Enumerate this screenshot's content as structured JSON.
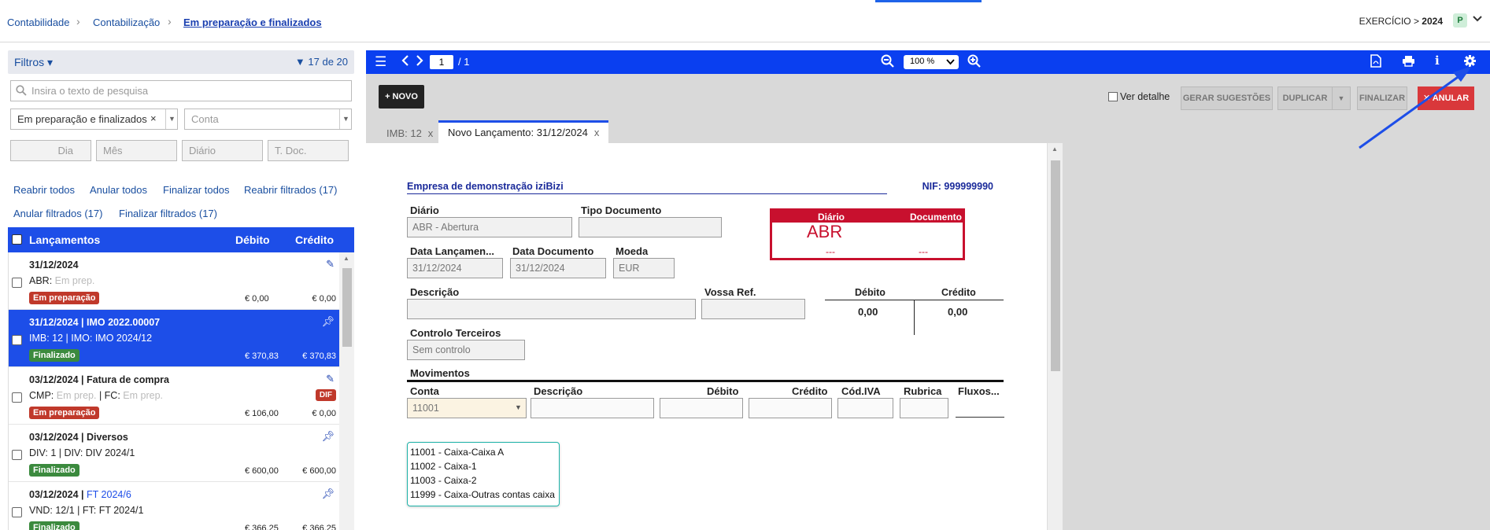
{
  "breadcrumb": [
    "Contabilidade",
    "Contabilização",
    "Em preparação e finalizados"
  ],
  "exercicio": {
    "label": "EXERCÍCIO >",
    "year": "2024",
    "badge": "P"
  },
  "filters": {
    "label": "Filtros",
    "count": "17 de 20",
    "search_placeholder": "Insira o texto de pesquisa",
    "status_value": "Em preparação e finalizados",
    "conta_placeholder": "Conta",
    "dia_placeholder": "Dia",
    "mes_placeholder": "Mês",
    "diario_placeholder": "Diário",
    "tdoc_placeholder": "T. Doc."
  },
  "actions": [
    "Reabrir todos",
    "Anular todos",
    "Finalizar todos",
    "Reabrir filtrados (17)",
    "Anular filtrados (17)",
    "Finalizar filtrados (17)"
  ],
  "list": {
    "headers": {
      "lancamentos": "Lançamentos",
      "debito": "Débito",
      "credito": "Crédito"
    },
    "rows": [
      {
        "date": "31/12/2024",
        "num": "",
        "line1a": "ABR:",
        "line1b": "Em prep.",
        "line1c": "",
        "line1d": "",
        "status": "Em preparação",
        "debit": "€ 0,00",
        "credit": "€ 0,00"
      },
      {
        "date": "31/12/2024 | IMO 2022.00007",
        "num": "",
        "line1a": "IMB: 12 | IMO: IMO 2024/12",
        "line1b": "",
        "line1c": "",
        "line1d": "",
        "status": "Finalizado",
        "debit": "€ 370,83",
        "credit": "€ 370,83"
      },
      {
        "date": "03/12/2024 | Fatura de compra",
        "num": "",
        "line1a": "CMP:",
        "line1b": "Em prep.",
        "line1c": "| FC:",
        "line1d": "Em prep.",
        "status": "Em preparação",
        "debit": "€ 106,00",
        "credit": "€ 0,00",
        "dif": "DIF"
      },
      {
        "date": "03/12/2024 | Diversos",
        "num": "",
        "line1a": "DIV: 1 | DIV: DIV 2024/1",
        "line1b": "",
        "line1c": "",
        "line1d": "",
        "status": "Finalizado",
        "debit": "€ 600,00",
        "credit": "€ 600,00"
      },
      {
        "date": "03/12/2024 |",
        "num": "FT 2024/6",
        "line1a": "VND: 12/1 | FT: FT 2024/1",
        "line1b": "",
        "line1c": "",
        "line1d": "",
        "status": "Finalizado",
        "debit": "€ 366,25",
        "credit": "€ 366,25"
      }
    ]
  },
  "viewer": {
    "page": "1",
    "page_total": "/ 1",
    "zoom": "100 %",
    "novo": "+ NOVO",
    "ver_detalhe": "Ver detalhe",
    "gerar": "GERAR SUGESTÕES",
    "duplicar": "DUPLICAR",
    "finalizar": "FINALIZAR",
    "anular": "ANULAR",
    "tabs": [
      {
        "label": "IMB: 12",
        "close": "x"
      },
      {
        "label": "Novo Lançamento: 31/12/2024",
        "close": "x"
      }
    ]
  },
  "doc": {
    "company": "Empresa de demonstração iziBizi",
    "nif": "NIF: 999999990",
    "diario_label": "Diário",
    "diario_value": "ABR - Abertura",
    "tipo_doc_label": "Tipo Documento",
    "box": {
      "h_diario": "Diário",
      "h_documento": "Documento",
      "big": "ABR",
      "dash1": "---",
      "dash2": "---"
    },
    "data_lanc_label": "Data Lançamen...",
    "data_lanc_value": "31/12/2024",
    "data_doc_label": "Data Documento",
    "data_doc_value": "31/12/2024",
    "moeda_label": "Moeda",
    "moeda_value": "EUR",
    "descricao_label": "Descrição",
    "vossa_ref_label": "Vossa Ref.",
    "debito_label": "Débito",
    "credito_label": "Crédito",
    "debito_total": "0,00",
    "credito_total": "0,00",
    "controlo_label": "Controlo Terceiros",
    "controlo_value": "Sem controlo",
    "movimentos_label": "Movimentos",
    "mov_headers": {
      "conta": "Conta",
      "descricao": "Descrição",
      "debito": "Débito",
      "credito": "Crédito",
      "cod_iva": "Cód.IVA",
      "rubrica": "Rubrica",
      "fluxos": "Fluxos..."
    },
    "conta_value": "11001",
    "dropdown": [
      "11001 - Caixa-Caixa A",
      "11002 - Caixa-1",
      "11003 - Caixa-2",
      "11999 - Caixa-Outras contas caixa"
    ]
  }
}
